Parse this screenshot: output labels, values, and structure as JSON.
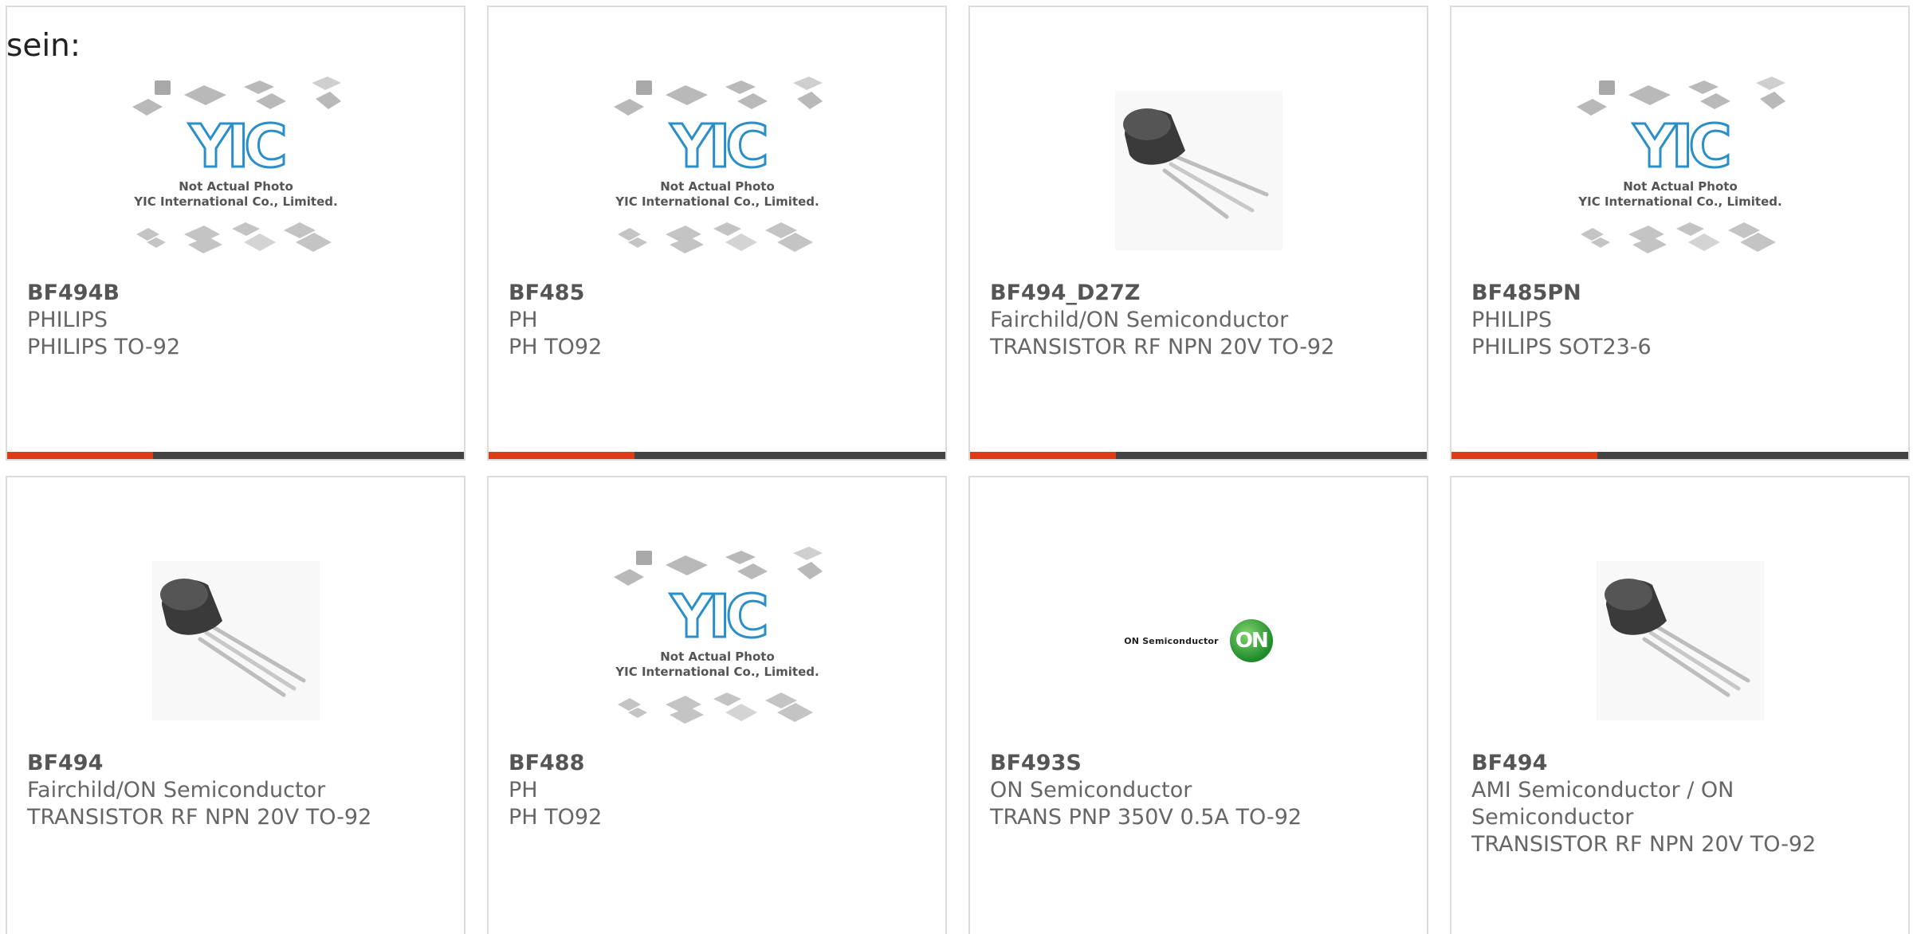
{
  "lead_text": "sein:",
  "colors": {
    "accent": "#e03a17",
    "bar": "#444444",
    "border": "#dcdcdc"
  },
  "placeholder": {
    "logo": "YIC",
    "line1": "Not Actual Photo",
    "line2": "YIC International Co., Limited."
  },
  "brand_image": {
    "name": "ON Semiconductor",
    "logo": "ON"
  },
  "products": [
    {
      "part": "BF494B",
      "manufacturer": "PHILIPS",
      "description": "PHILIPS TO-92",
      "image": "placeholder-chip-icons",
      "progress": 0.32
    },
    {
      "part": "BF485",
      "manufacturer": "PH",
      "description": "PH TO92",
      "image": "placeholder-chip-icons",
      "progress": 0.32
    },
    {
      "part": "BF494_D27Z",
      "manufacturer": "Fairchild/ON Semiconductor",
      "description": "TRANSISTOR RF NPN 20V TO-92",
      "image": "transistor-to92",
      "progress": 0.32
    },
    {
      "part": "BF485PN",
      "manufacturer": "PHILIPS",
      "description": "PHILIPS SOT23-6",
      "image": "placeholder-chip-icons",
      "progress": 0.32
    },
    {
      "part": "BF494",
      "manufacturer": "Fairchild/ON Semiconductor",
      "description": "TRANSISTOR RF NPN 20V TO-92",
      "image": "transistor-to92"
    },
    {
      "part": "BF488",
      "manufacturer": "PH",
      "description": "PH TO92",
      "image": "placeholder-chip-icons"
    },
    {
      "part": "BF493S",
      "manufacturer": "ON Semiconductor",
      "description": "TRANS PNP 350V 0.5A TO-92",
      "image": "on-semiconductor-logo"
    },
    {
      "part": "BF494",
      "manufacturer": "AMI Semiconductor / ON Semiconductor",
      "description": "TRANSISTOR RF NPN 20V TO-92",
      "image": "transistor-to92"
    }
  ]
}
